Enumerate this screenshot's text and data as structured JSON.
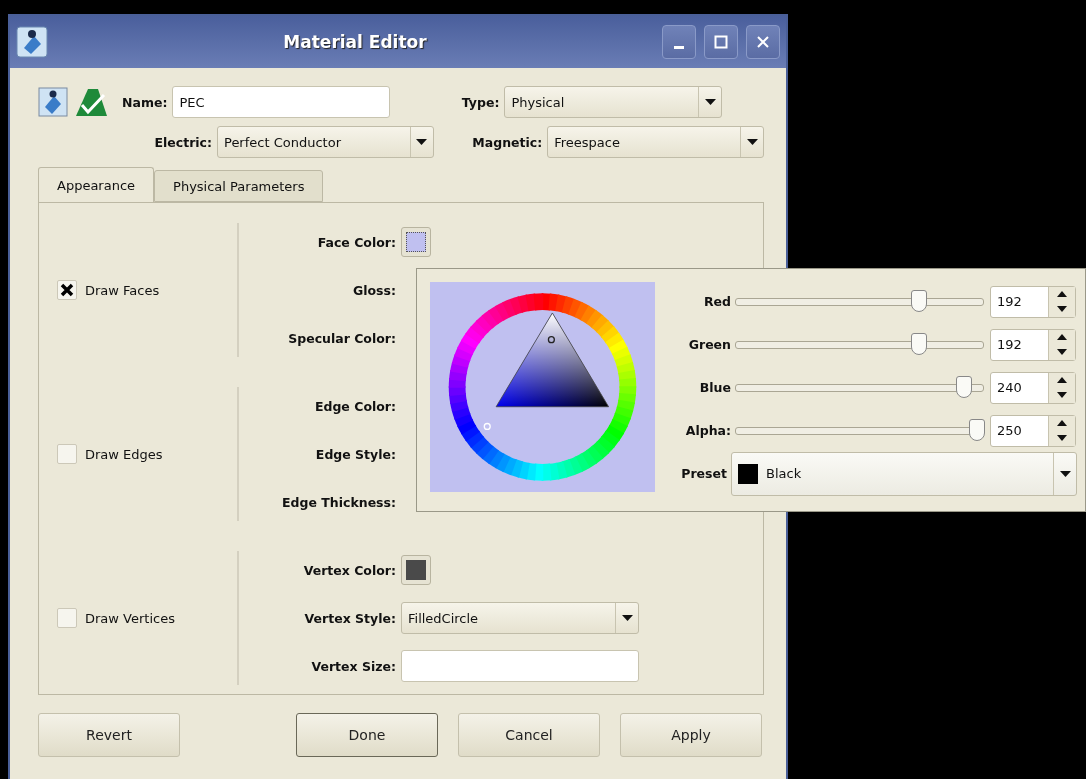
{
  "window": {
    "title": "Material Editor"
  },
  "header": {
    "name": {
      "label": "Name:",
      "value": "PEC"
    },
    "type": {
      "label": "Type:",
      "value": "Physical"
    },
    "electric": {
      "label": "Electric:",
      "value": "Perfect Conductor"
    },
    "magnetic": {
      "label": "Magnetic:",
      "value": "Freespace"
    }
  },
  "tabs": [
    {
      "label": "Appearance",
      "selected": true
    },
    {
      "label": "Physical Parameters",
      "selected": false
    }
  ],
  "groups": [
    {
      "checkbox": {
        "label": "Draw Faces",
        "checked": true
      },
      "rows": [
        {
          "kind": "color",
          "label": "Face Color:",
          "color": "#c0c0f0"
        },
        {
          "kind": "label",
          "label": "Gloss:"
        },
        {
          "kind": "label",
          "label": "Specular Color:"
        }
      ]
    },
    {
      "checkbox": {
        "label": "Draw Edges",
        "checked": false
      },
      "rows": [
        {
          "kind": "label",
          "label": "Edge Color:"
        },
        {
          "kind": "label",
          "label": "Edge Style:"
        },
        {
          "kind": "label",
          "label": "Edge Thickness:"
        }
      ]
    },
    {
      "checkbox": {
        "label": "Draw Vertices",
        "checked": false
      },
      "rows": [
        {
          "kind": "color",
          "label": "Vertex Color:",
          "color": "#4a4a4a"
        },
        {
          "kind": "select",
          "label": "Vertex Style:",
          "value": "FilledCircle"
        },
        {
          "kind": "input",
          "label": "Vertex Size:"
        }
      ]
    }
  ],
  "color_popup": {
    "sliders": [
      {
        "label": "Red",
        "level": 0.74,
        "value": "192"
      },
      {
        "label": "Green",
        "level": 0.74,
        "value": "192"
      },
      {
        "label": "Blue",
        "level": 0.92,
        "value": "240"
      },
      {
        "label": "Alpha:",
        "level": 0.97,
        "value": "250"
      }
    ],
    "preset": {
      "label": "Preset",
      "value": "Black",
      "color": "#000000"
    }
  },
  "buttons": [
    {
      "label": "Revert",
      "default": false
    },
    {
      "label": "Done",
      "default": true
    },
    {
      "label": "Cancel",
      "default": false
    },
    {
      "label": "Apply",
      "default": false
    }
  ]
}
